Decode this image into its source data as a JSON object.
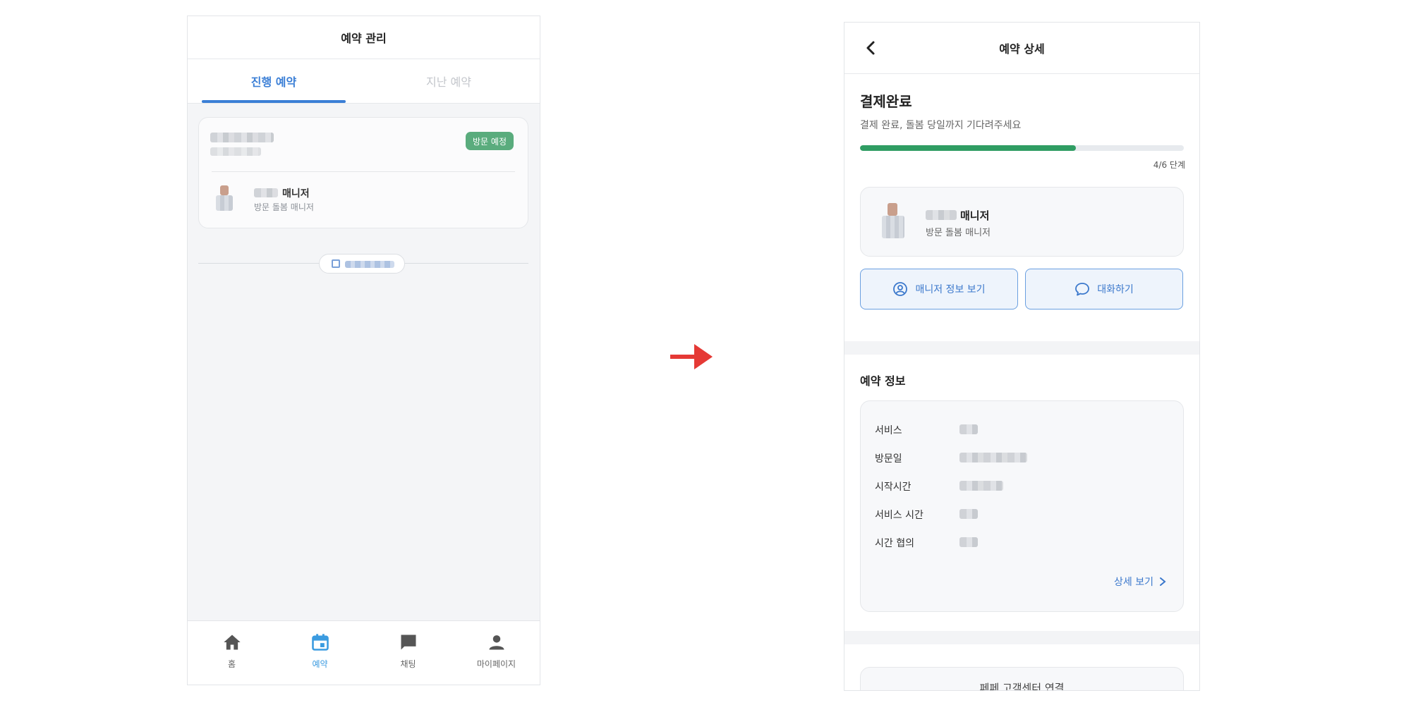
{
  "left_screen": {
    "header_title": "예약 관리",
    "tabs": [
      {
        "label": "진행 예약",
        "active": true
      },
      {
        "label": "지난 예약",
        "active": false
      }
    ],
    "reservation_card": {
      "badge": "방문 예정",
      "badge_color": "#5aac7d",
      "manager_suffix": "매니저",
      "manager_role": "방문 돌봄 매니저"
    },
    "bottom_nav": [
      {
        "label": "홈",
        "icon": "home-icon",
        "active": false
      },
      {
        "label": "예약",
        "icon": "calendar-icon",
        "active": true
      },
      {
        "label": "채팅",
        "icon": "chat-icon",
        "active": false
      },
      {
        "label": "마이페이지",
        "icon": "person-icon",
        "active": false
      }
    ]
  },
  "right_screen": {
    "header_title": "예약 상세",
    "status_title": "결제완료",
    "status_desc": "결제 완료, 돌봄 당일까지 기다려주세요",
    "progress_text": "4/6 단계",
    "progress_fraction": 0.667,
    "progress_color": "#2f9d63",
    "manager_suffix": "매니저",
    "manager_role": "방문 돌봄 매니저",
    "buttons": {
      "manager_info": "매니저 정보 보기",
      "chat": "대화하기"
    },
    "section_title": "예약 정보",
    "info_labels": [
      "서비스",
      "방문일",
      "시작시간",
      "서비스 시간",
      "시간 협의"
    ],
    "detail_link": "상세 보기",
    "customer_center": "페페 고객센터 연결"
  },
  "accent_color": "#3b7fd6"
}
